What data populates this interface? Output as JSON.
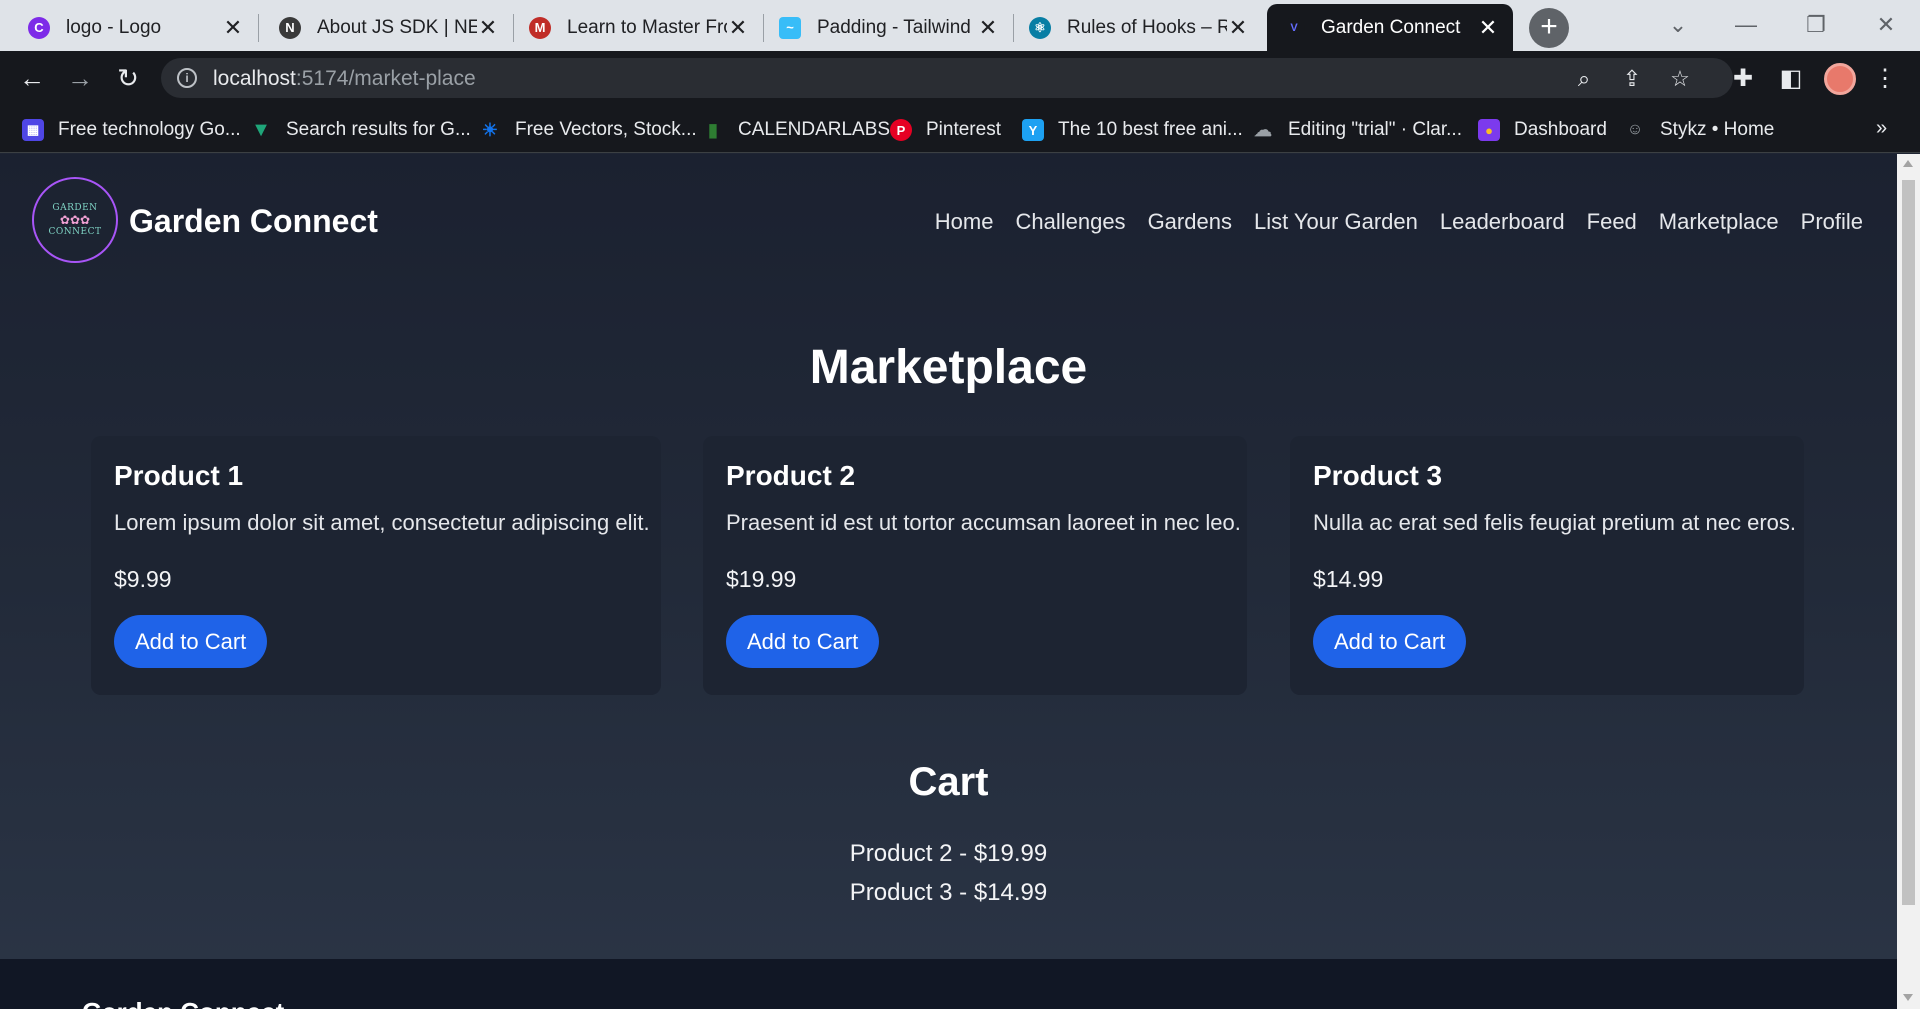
{
  "browser": {
    "tabs": [
      {
        "title": "logo - Logo",
        "icon": "canva-icon",
        "color": "#7d2ae8"
      },
      {
        "title": "About JS SDK | NEAR",
        "icon": "near-icon",
        "color": "#3a3a3a"
      },
      {
        "title": "Learn to Master Frontend",
        "icon": "frontend-masters-icon",
        "color": "#c02d28"
      },
      {
        "title": "Padding - Tailwind CSS",
        "icon": "tailwind-icon",
        "color": "#38bdf8"
      },
      {
        "title": "Rules of Hooks – React",
        "icon": "react-icon",
        "color": "#087ea4"
      },
      {
        "title": "Garden Connect",
        "icon": "vite-icon",
        "color": "#646cff"
      }
    ],
    "new_tab": "+",
    "url_host": "localhost",
    "url_path": ":5174/market-place",
    "bookmarks": [
      {
        "label": "Free technology Go...",
        "icon": "bookmark-tech-icon",
        "color": "#4f46e5"
      },
      {
        "label": "Search results for G...",
        "icon": "bookmark-vuetify-icon",
        "color": "#1fa67a"
      },
      {
        "label": "Free Vectors, Stock...",
        "icon": "bookmark-freepik-icon",
        "color": "#1273eb"
      },
      {
        "label": "CALENDARLABS",
        "icon": "bookmark-calendar-icon",
        "color": "#2e7d32"
      },
      {
        "label": "Pinterest",
        "icon": "pinterest-icon",
        "color": "#e60023"
      },
      {
        "label": "The 10 best free ani...",
        "icon": "bookmark-anim-icon",
        "color": "#1da1f2"
      },
      {
        "label": "Editing \"trial\" · Clar...",
        "icon": "bookmark-cloud-icon",
        "color": "#9aa0a6"
      },
      {
        "label": "Dashboard",
        "icon": "bookmark-dashboard-icon",
        "color": "#7c3aed"
      },
      {
        "label": "Stykz • Home",
        "icon": "bookmark-stykz-icon",
        "color": "#9aa0a6"
      }
    ],
    "more": "»"
  },
  "site": {
    "title": "Garden Connect",
    "logo_text": "GARDEN",
    "logo_text2": "CONNECT",
    "nav": [
      "Home",
      "Challenges",
      "Gardens",
      "List Your Garden",
      "Leaderboard",
      "Feed",
      "Marketplace",
      "Profile"
    ]
  },
  "marketplace": {
    "heading": "Marketplace",
    "products": [
      {
        "name": "Product 1",
        "description": "Lorem ipsum dolor sit amet, consectetur adipiscing elit.",
        "price": "$9.99",
        "button": "Add to Cart"
      },
      {
        "name": "Product 2",
        "description": "Praesent id est ut tortor accumsan laoreet in nec leo.",
        "price": "$19.99",
        "button": "Add to Cart"
      },
      {
        "name": "Product 3",
        "description": "Nulla ac erat sed felis feugiat pretium at nec eros.",
        "price": "$14.99",
        "button": "Add to Cart"
      }
    ]
  },
  "cart": {
    "heading": "Cart",
    "items": [
      "Product 2 - $19.99",
      "Product 3 - $14.99"
    ]
  },
  "footer": {
    "title": "Garden Connect"
  }
}
